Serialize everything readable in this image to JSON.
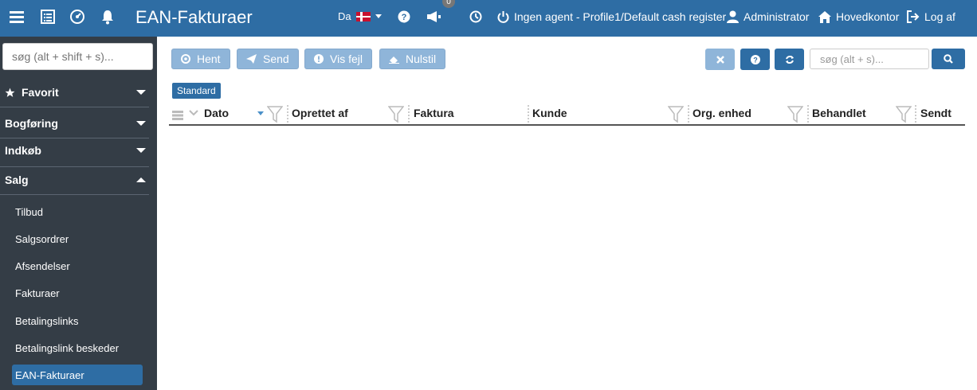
{
  "topbar": {
    "title": "EAN-Fakturaer",
    "language": "Da",
    "notification_count": "0",
    "agent_status": "Ingen agent - Profile1/Default cash register",
    "user": "Administrator",
    "location": "Hovedkontor",
    "logout": "Log af",
    "icons": [
      "menu-icon",
      "list-icon",
      "dashboard-icon",
      "bell-icon",
      "danish-flag-icon",
      "help-icon",
      "megaphone-icon",
      "clock-icon",
      "power-icon",
      "user-icon",
      "home-icon",
      "logout-icon"
    ]
  },
  "sidebar": {
    "search_placeholder": "søg (alt + shift + s)...",
    "sections": [
      {
        "label": "Favorit",
        "expanded": false
      },
      {
        "label": "Bogføring",
        "expanded": false
      },
      {
        "label": "Indkøb",
        "expanded": false
      },
      {
        "label": "Salg",
        "expanded": true
      }
    ],
    "items": [
      "Tilbud",
      "Salgsordrer",
      "Afsendelser",
      "Fakturaer",
      "Betalingslinks",
      "Betalingslink beskeder",
      "EAN-Fakturaer"
    ],
    "active_item": "EAN-Fakturaer"
  },
  "toolbar": {
    "hent": "Hent",
    "send": "Send",
    "vis_fejl": "Vis fejl",
    "nulstil": "Nulstil",
    "search_placeholder": "søg (alt + s)..."
  },
  "view_tag": "Standard",
  "table": {
    "columns": [
      "Dato",
      "Oprettet af",
      "Faktura",
      "Kunde",
      "Org. enhed",
      "Behandlet",
      "Sendt"
    ],
    "sort_column": "Dato",
    "sort_direction": "descending",
    "rows": []
  },
  "colors": {
    "accent": "#2e6da4",
    "sidebar_bg": "#343d46",
    "button_disabled": "#8fb5d9"
  }
}
